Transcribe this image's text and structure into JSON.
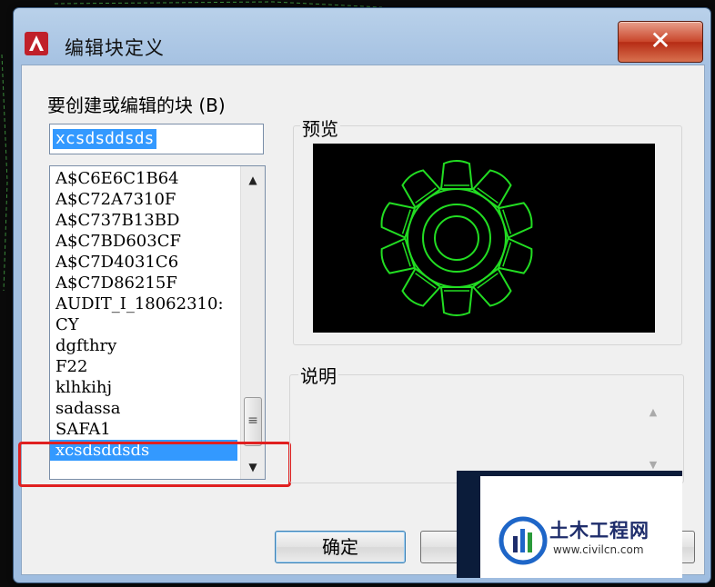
{
  "window": {
    "title": "编辑块定义",
    "close_label": "✕"
  },
  "block_section": {
    "label": "要创建或编辑的块 (B)",
    "input_value": "xcsdsddsds"
  },
  "block_list": {
    "items": [
      "A$C6E6C1B64",
      "A$C72A7310F",
      "A$C737B13BD",
      "A$C7BD603CF",
      "A$C7D4031C6",
      "A$C7D86215F",
      "AUDIT_I_18062310:",
      "CY",
      "dgfthry",
      "F22",
      "klhkihj",
      "sadassa",
      "SAFA1",
      "xcsdsddsds"
    ],
    "selected": "xcsdsddsds"
  },
  "preview": {
    "label": "预览"
  },
  "description": {
    "label": "说明"
  },
  "buttons": {
    "ok": "确定"
  },
  "watermark": {
    "title": "土木工程网",
    "url": "www.civilcn.com"
  },
  "colors": {
    "preview_stroke": "#22dd22",
    "selection": "#3399ff",
    "highlight": "#e02020"
  }
}
